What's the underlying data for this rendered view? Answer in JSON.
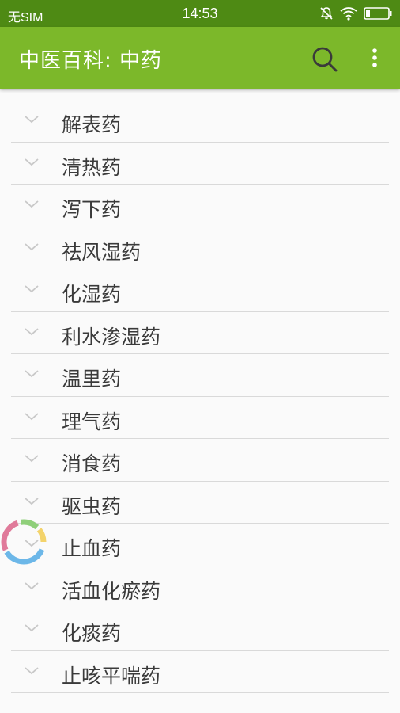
{
  "status": {
    "carrier": "无SIM",
    "time": "14:53",
    "icons": [
      "mute-icon",
      "wifi-icon",
      "battery-icon"
    ]
  },
  "header": {
    "title": "中医百科: 中药"
  },
  "categories": [
    {
      "label": "解表药"
    },
    {
      "label": "清热药"
    },
    {
      "label": "泻下药"
    },
    {
      "label": "祛风湿药"
    },
    {
      "label": "化湿药"
    },
    {
      "label": "利水渗湿药"
    },
    {
      "label": "温里药"
    },
    {
      "label": "理气药"
    },
    {
      "label": "消食药"
    },
    {
      "label": "驱虫药"
    },
    {
      "label": "止血药"
    },
    {
      "label": "活血化瘀药"
    },
    {
      "label": "化痰药"
    },
    {
      "label": "止咳平喘药"
    }
  ],
  "colors": {
    "status_bar": "#4e8a14",
    "app_bar": "#7cb82a",
    "background": "#fafafa"
  }
}
